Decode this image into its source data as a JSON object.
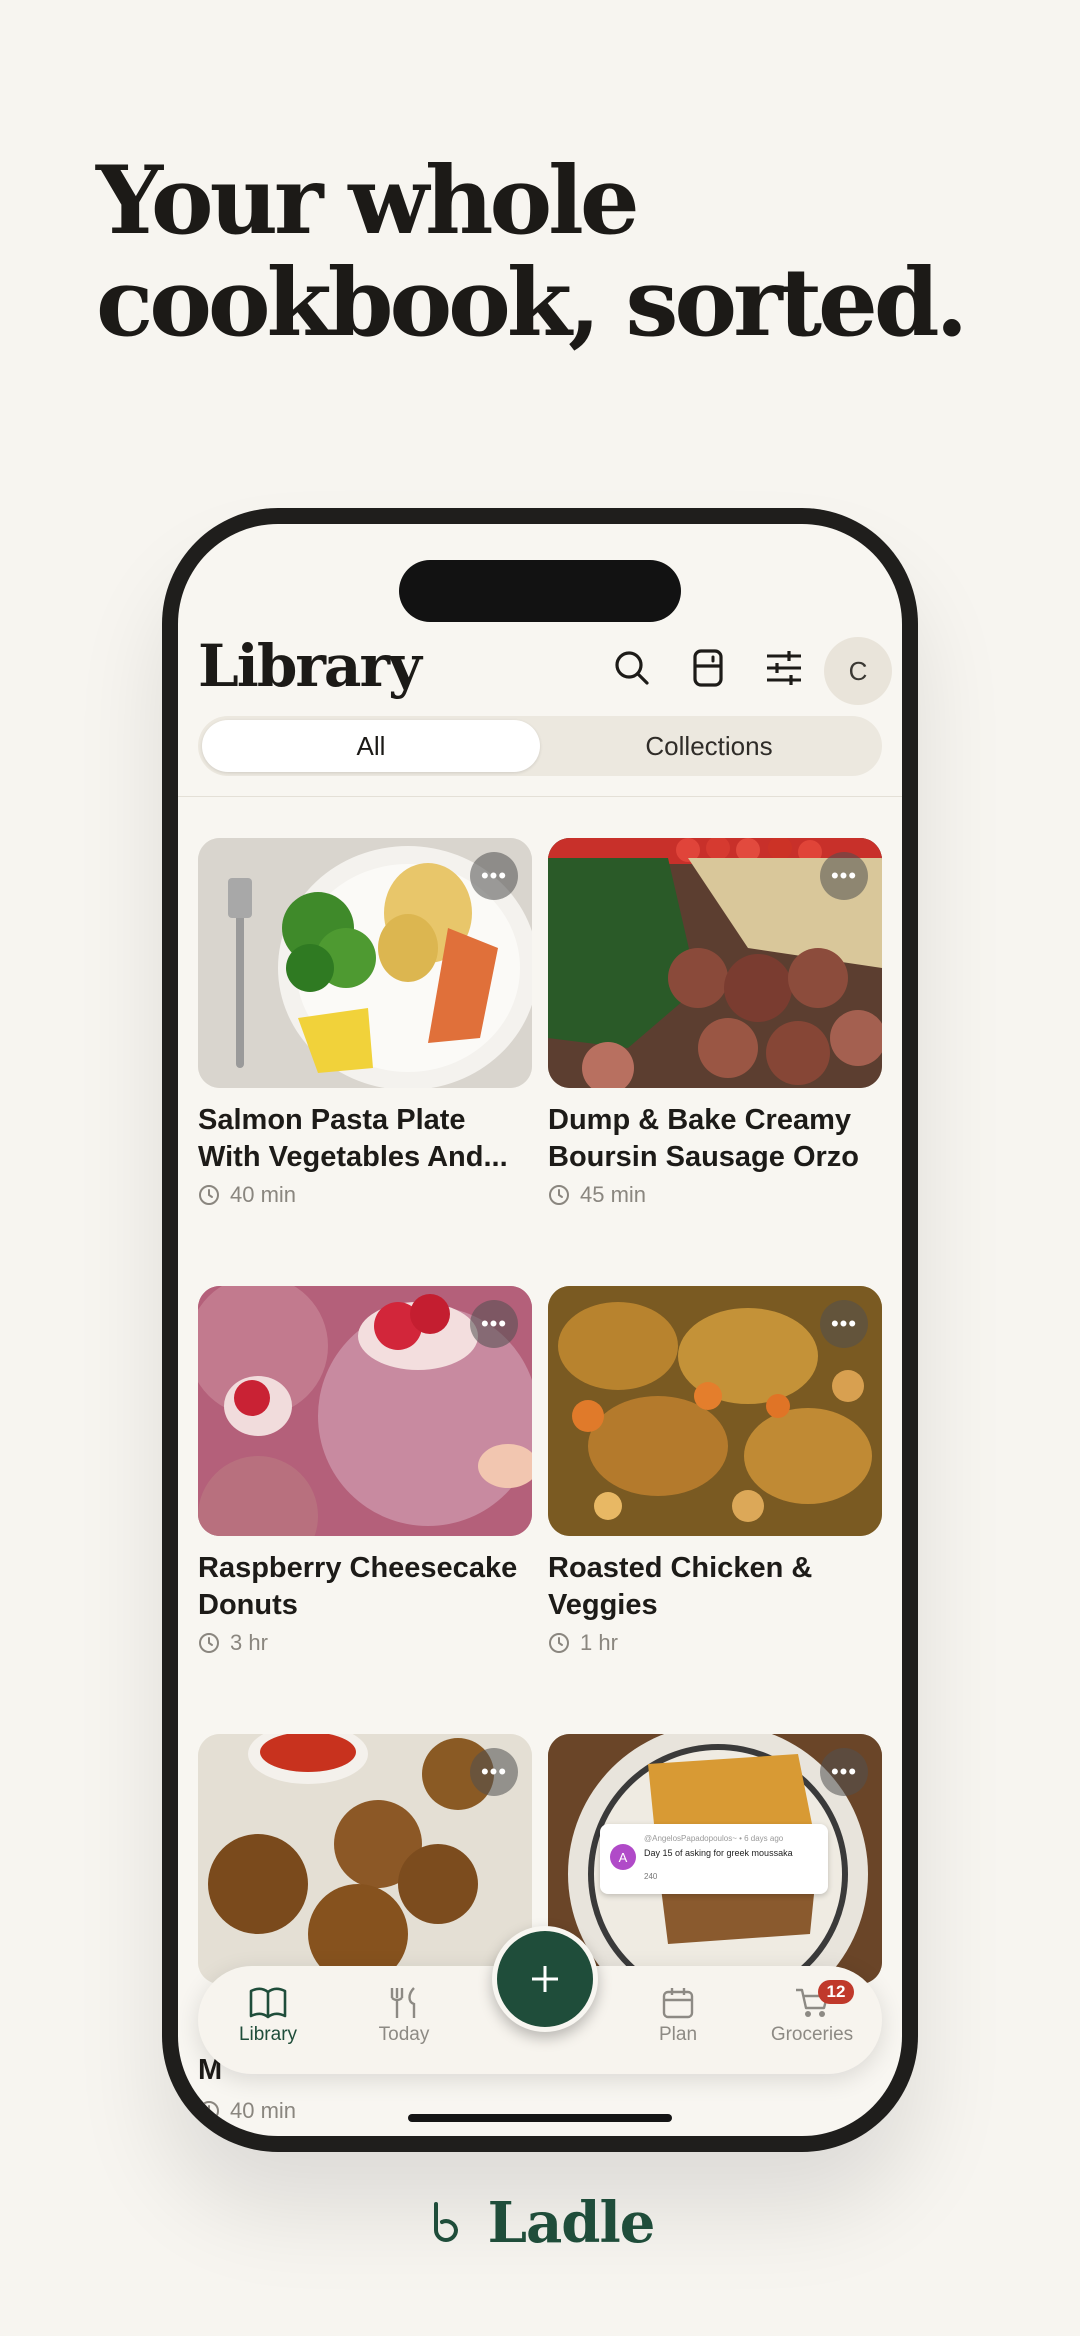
{
  "headline": {
    "line1": "Your whole",
    "line2": "cookbook, sorted."
  },
  "app": {
    "title": "Library",
    "avatar_initial": "C",
    "tabs": {
      "all": "All",
      "collections": "Collections"
    },
    "header_icons": [
      "search-icon",
      "fridge-icon",
      "filter-sliders-icon"
    ],
    "recipes": [
      {
        "title": "Salmon Pasta Plate With Vegetables And...",
        "time": "40 min"
      },
      {
        "title": "Dump & Bake Creamy Boursin Sausage Orzo",
        "time": "45 min"
      },
      {
        "title": "Raspberry Cheesecake Donuts",
        "time": "3 hr"
      },
      {
        "title": "Roasted Chicken & Veggies",
        "time": "1 hr"
      },
      {
        "title": "M",
        "time": "40 min"
      },
      {
        "title": "",
        "time": ""
      }
    ],
    "embedded_comment": {
      "author": "@AngelosPapadopoulos~ • 6 days ago",
      "text": "Day 15 of asking for greek moussaka",
      "likes": "240"
    },
    "bottom_nav": {
      "library": "Library",
      "today": "Today",
      "plan": "Plan",
      "groceries": "Groceries",
      "groceries_badge": "12"
    },
    "more_glyph": "•••"
  },
  "brand": {
    "name": "Ladle"
  },
  "colors": {
    "accent": "#1f4d3a",
    "badge": "#c0392b",
    "background": "#f7f5f0"
  }
}
